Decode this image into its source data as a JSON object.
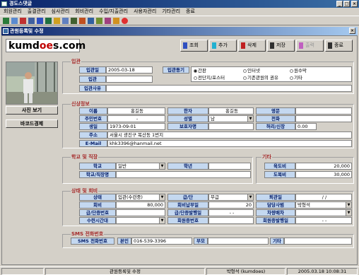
{
  "window": {
    "title": "경도스댓글"
  },
  "menu": [
    "회원관리",
    "출결관리",
    "심사관리",
    "회비관리",
    "수입/지출관리",
    "사용자관리",
    "기타관리",
    "종료"
  ],
  "form_title": "관원등록및 수정",
  "logo": {
    "pre": "kumd",
    "oo": "oe",
    "post": "s.com"
  },
  "actions": [
    {
      "label": "조회",
      "color": "#3050c0",
      "disabled": false
    },
    {
      "label": "추가",
      "color": "#20b0d0",
      "disabled": false
    },
    {
      "label": "삭제",
      "color": "#c02020",
      "disabled": false
    },
    {
      "label": "저장",
      "color": "#303030",
      "disabled": false
    },
    {
      "label": "출력",
      "color": "#c060c0",
      "disabled": true
    },
    {
      "label": "종료",
      "color": "#303030",
      "disabled": false
    }
  ],
  "photo_buttons": {
    "view": "사진 보기",
    "barcode": "바코드경제"
  },
  "entry": {
    "section": "입관",
    "date_label": "입관일",
    "date_value": "2005-03-18",
    "type_label": "입관",
    "reason_label": "입관사유",
    "motive_label": "입관동기",
    "motives": [
      {
        "label": "간판",
        "checked": true
      },
      {
        "label": "인터넷",
        "checked": false
      },
      {
        "label": "원수막",
        "checked": false
      },
      {
        "label": "전단지/포스터",
        "checked": false
      },
      {
        "label": "기존관원의 권유",
        "checked": false
      },
      {
        "label": "기타",
        "checked": false
      }
    ]
  },
  "personal": {
    "section": "신상정보",
    "name_label": "이름",
    "name_value": "홍길동",
    "hanja_label": "한자",
    "hanja_value": "홍길동",
    "eng_label": "영문",
    "eng_value": "",
    "rrn_label": "주민번호",
    "rrn_value": "-",
    "gender_label": "성별",
    "gender_value": "남",
    "phone_label": "전화",
    "phone_value": "",
    "birth_label": "생일",
    "birth_value": "1973-09-01",
    "guardian_label": "보호자명",
    "guardian_value": "",
    "height_label": "허리/신장",
    "height_value": "0.00",
    "addr_label": "주소",
    "addr_value": "서울시 광진구 복산동 1번지",
    "email_label": "E-Mail",
    "email_value": "khk3396@hanmail.net"
  },
  "school": {
    "section": "학교 및 직장",
    "school_label": "학교",
    "school_value": "일반",
    "grade_label": "학년",
    "grade_value": "",
    "job_label": "학교/직장명",
    "job_value": ""
  },
  "other": {
    "section": "기타",
    "fee_label": "육도비",
    "fee_value": "20,000",
    "belt_label": "도복비",
    "belt_value": "30,000"
  },
  "status": {
    "section": "상태 및 회비",
    "state_label": "상태",
    "state_value": "입관(수련중)",
    "rank_label": "급/단",
    "rank_value": "무급",
    "leave_label": "퇴관일",
    "leave_value": "/ /",
    "fee_label": "회비",
    "fee_value": "80,000",
    "due_label": "회비납부일",
    "due_value": "20",
    "teacher_label": "담당사범",
    "teacher_value": "박형석",
    "cert_label": "급/단증번호",
    "cert_value": "",
    "cert_date_label": "급/단증발행일",
    "cert_date_value": "- -",
    "car_label": "차량배차",
    "car_value": "",
    "time_label": "수련시간대",
    "time_value": "",
    "member_no_label": "회원증번호",
    "member_no_value": "",
    "member_date_label": "회원증발행일",
    "member_date_value": "- -"
  },
  "sms": {
    "section": "SMS 전화번호",
    "label": "SMS 전화번호",
    "self_label": "본인",
    "self_value": "016-539-3396",
    "father_label": "부모",
    "father_value": "",
    "etc_label": "기타",
    "etc_value": ""
  },
  "statusbar": {
    "form": "관원등록및 수정",
    "user": "박형석 (kumdoes)",
    "datetime": "2005.03.18  10:08:31"
  }
}
